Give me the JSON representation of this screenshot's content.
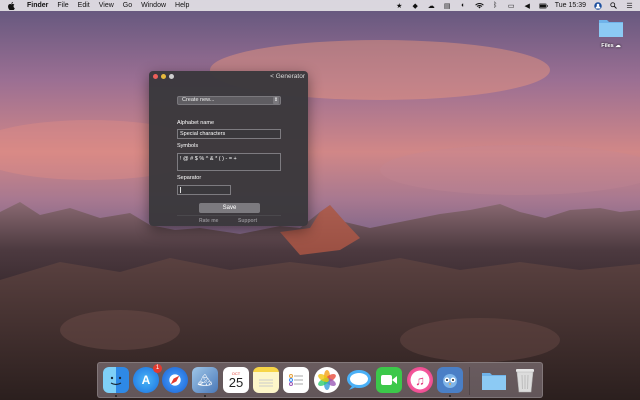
{
  "menubar": {
    "app_name": "Finder",
    "menus": [
      "File",
      "Edit",
      "View",
      "Go",
      "Window",
      "Help"
    ],
    "clock": "Tue 15:39"
  },
  "desktop": {
    "files_label": "Files"
  },
  "window": {
    "back_label": "< Generator",
    "create_select": "Create new...",
    "alphabet_label": "Alphabet name",
    "alphabet_value": "Special characters",
    "symbols_label": "Symbols",
    "symbols_value": "! @ # $ % ^ & * ( ) - = +",
    "separator_label": "Separator",
    "separator_value": "",
    "save_label": "Save",
    "rate_label": "Rate me",
    "support_label": "Support"
  },
  "dock": {
    "appstore_badge": "1",
    "calendar_month": "OCT",
    "calendar_day": "25"
  },
  "colors": {
    "window_bg": "#3a383c",
    "close": "#ee5f5a",
    "minimize": "#e7b93d",
    "badge": "#e23a2f"
  }
}
